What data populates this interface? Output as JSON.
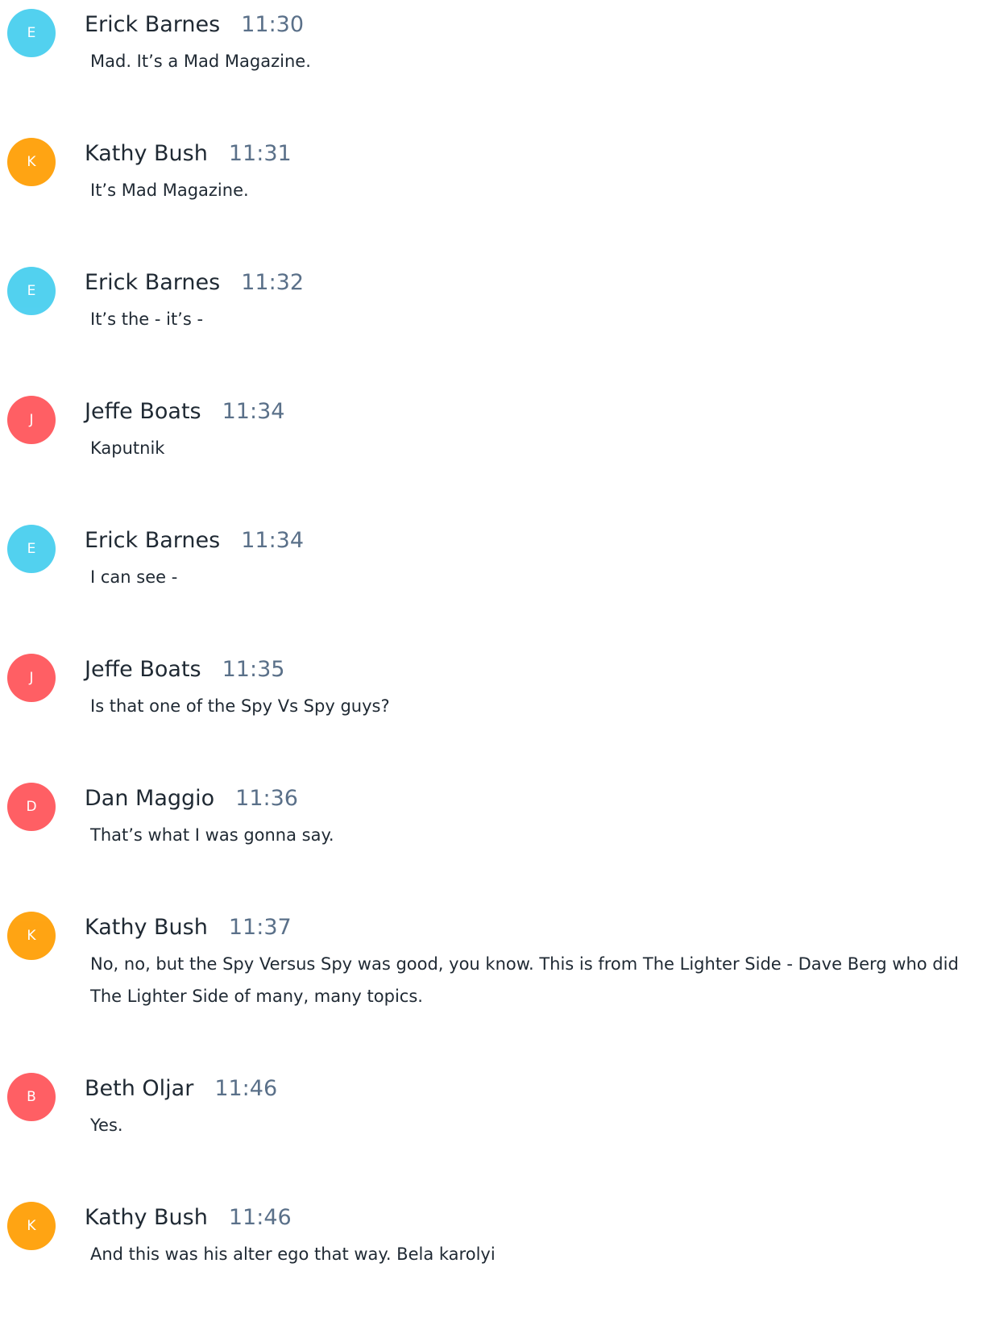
{
  "messages": [
    {
      "initial": "E",
      "speaker": "Erick Barnes",
      "time": "11:30",
      "text": "Mad. It’s a Mad Magazine.",
      "avatar_color": "#4dd0ef"
    },
    {
      "initial": "K",
      "speaker": "Kathy Bush",
      "time": "11:31",
      "text": "It’s Mad Magazine.",
      "avatar_color": "#ffa20c"
    },
    {
      "initial": "E",
      "speaker": "Erick Barnes",
      "time": "11:32",
      "text": "It’s the - it’s -",
      "avatar_color": "#4dd0ef"
    },
    {
      "initial": "J",
      "speaker": "Jeffe Boats",
      "time": "11:34",
      "text": "Kaputnik",
      "avatar_color": "#ff5a5f"
    },
    {
      "initial": "E",
      "speaker": "Erick Barnes",
      "time": "11:34",
      "text": "I can see -",
      "avatar_color": "#4dd0ef"
    },
    {
      "initial": "J",
      "speaker": "Jeffe Boats",
      "time": "11:35",
      "text": "Is that one of the Spy Vs Spy guys?",
      "avatar_color": "#ff5a5f"
    },
    {
      "initial": "D",
      "speaker": "Dan Maggio",
      "time": "11:36",
      "text": "That’s what I was gonna say.",
      "avatar_color": "#ff5a5f"
    },
    {
      "initial": "K",
      "speaker": "Kathy Bush",
      "time": "11:37",
      "text": "No, no, but the Spy Versus Spy was good, you know. This is from The Lighter Side - Dave Berg who did The Lighter Side of many, many topics.",
      "avatar_color": "#ffa20c"
    },
    {
      "initial": "B",
      "speaker": "Beth Oljar",
      "time": "11:46",
      "text": "Yes.",
      "avatar_color": "#ff5a5f"
    },
    {
      "initial": "K",
      "speaker": "Kathy Bush",
      "time": "11:46",
      "text": "And this was his alter ego that way. Bela karolyi",
      "avatar_color": "#ffa20c"
    }
  ]
}
